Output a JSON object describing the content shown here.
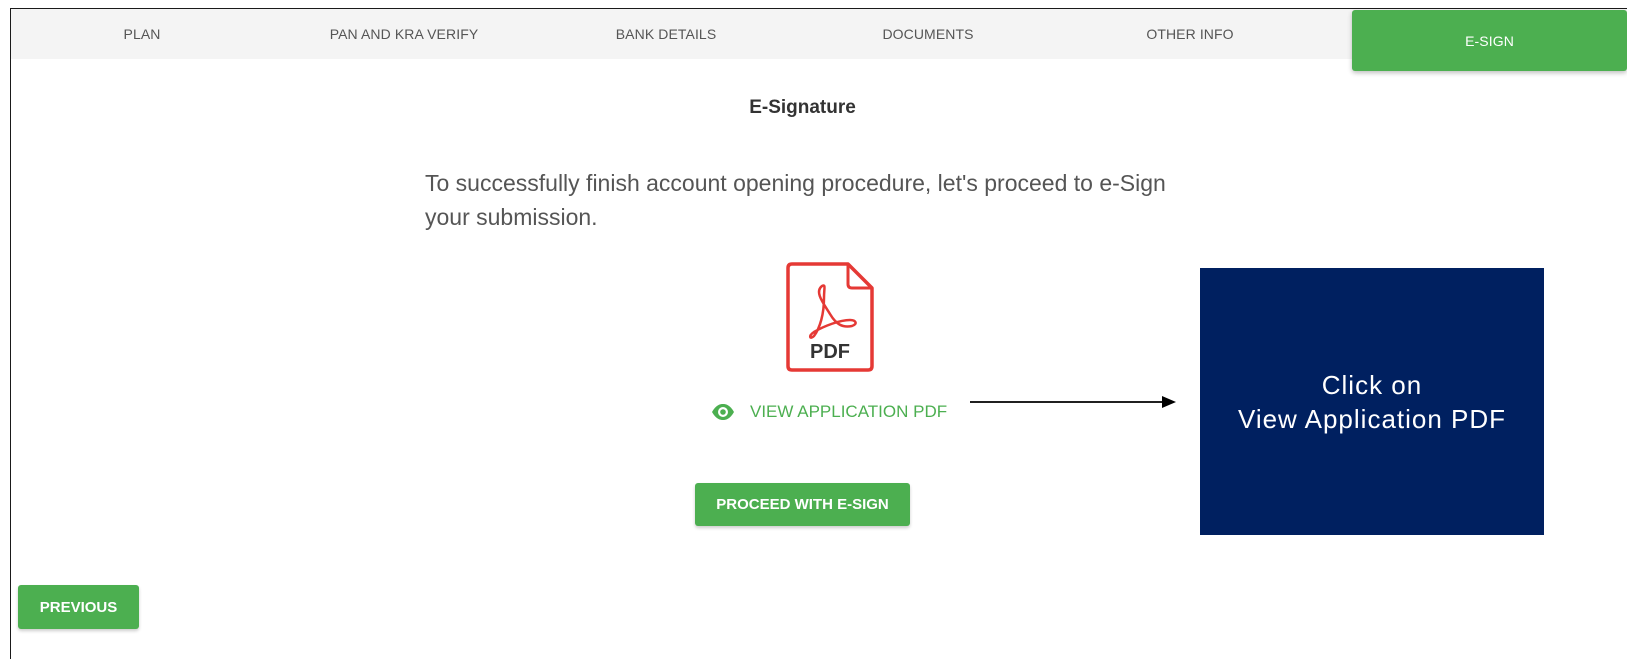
{
  "tabs": [
    {
      "label": "PLAN"
    },
    {
      "label": "PAN AND KRA VERIFY"
    },
    {
      "label": "BANK DETAILS"
    },
    {
      "label": "DOCUMENTS"
    },
    {
      "label": "OTHER INFO"
    },
    {
      "label": "E-SIGN",
      "active": true
    }
  ],
  "main": {
    "title": "E-Signature",
    "intro": "To successfully finish account opening procedure, let's proceed to e-Sign your submission.",
    "pdf_icon": {
      "name": "pdf-file-icon",
      "label": "PDF",
      "stroke_color": "#e53935"
    },
    "view_link": {
      "icon": "eye-icon",
      "label": "VIEW APPLICATION PDF"
    },
    "proceed_button": "PROCEED WITH E-SIGN"
  },
  "footer": {
    "previous_button": "PREVIOUS"
  },
  "callout": {
    "line1": "Click on",
    "line2": "View Application PDF",
    "background": "#002060"
  },
  "colors": {
    "accent": "#4caf50",
    "tab_bar": "#f4f4f4"
  }
}
